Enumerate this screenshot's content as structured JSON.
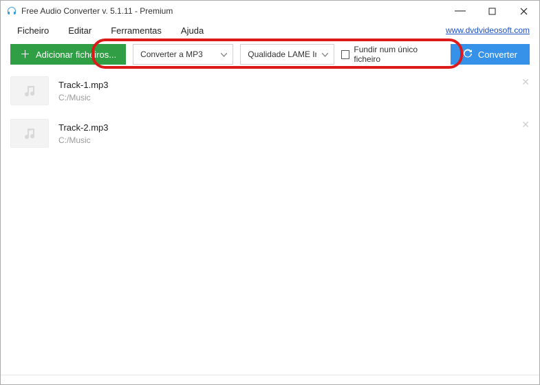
{
  "title": "Free Audio Converter v. 5.1.11 - Premium",
  "menu": {
    "file": "Ficheiro",
    "edit": "Editar",
    "tools": "Ferramentas",
    "help": "Ajuda"
  },
  "link": "www.dvdvideosoft.com",
  "toolbar": {
    "add": "Adicionar ficheiros...",
    "format": "Converter a MP3",
    "quality": "Qualidade LAME Insane",
    "merge": "Fundir num único ficheiro",
    "convert": "Converter"
  },
  "tracks": [
    {
      "name": "Track-1.mp3",
      "path": "C:/Music"
    },
    {
      "name": "Track-2.mp3",
      "path": "C:/Music"
    }
  ]
}
